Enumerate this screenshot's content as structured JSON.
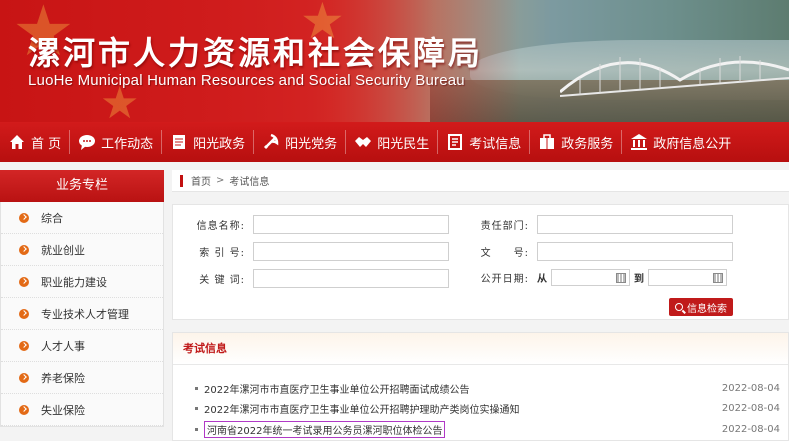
{
  "header": {
    "title_cn": "漯河市人力资源和社会保障局",
    "title_en": "LuoHe Municipal Human Resources and Social Security Bureau"
  },
  "nav": {
    "items": [
      {
        "label": "首 页",
        "icon": "home-icon"
      },
      {
        "label": "工作动态",
        "icon": "chat-bubble-icon"
      },
      {
        "label": "阳光政务",
        "icon": "document-icon"
      },
      {
        "label": "阳光党务",
        "icon": "party-emblem-icon"
      },
      {
        "label": "阳光民生",
        "icon": "handshake-icon"
      },
      {
        "label": "考试信息",
        "icon": "notepad-icon"
      },
      {
        "label": "政务服务",
        "icon": "briefcase-icon"
      },
      {
        "label": "政府信息公开",
        "icon": "building-icon"
      }
    ]
  },
  "sidebar": {
    "title": "业务专栏",
    "items": [
      "综合",
      "就业创业",
      "职业能力建设",
      "专业技术人才管理",
      "人才人事",
      "养老保险",
      "失业保险"
    ]
  },
  "breadcrumb": {
    "home": "首页",
    "separator": ">",
    "current": "考试信息"
  },
  "search": {
    "fields": {
      "info_name": "信息名称:",
      "department": "责任部门:",
      "index_no": "索 引 号:",
      "doc_no": "文　　号:",
      "keyword": "关 键 词:",
      "pub_date": "公开日期:",
      "from": "从",
      "to": "到"
    },
    "button": "信息检索"
  },
  "exam": {
    "title": "考试信息",
    "items": [
      {
        "title": "2022年漯河市市直医疗卫生事业单位公开招聘面试成绩公告",
        "date": "2022-08-04"
      },
      {
        "title": "2022年漯河市市直医疗卫生事业单位公开招聘护理助产类岗位实操通知",
        "date": "2022-08-04"
      },
      {
        "title": "河南省2022年统一考试录用公务员漯河职位体检公告",
        "date": "2022-08-04"
      }
    ]
  },
  "colors": {
    "primary_red": "#c01a1a",
    "accent_orange": "#e36a16",
    "highlight": "#b039c6"
  }
}
